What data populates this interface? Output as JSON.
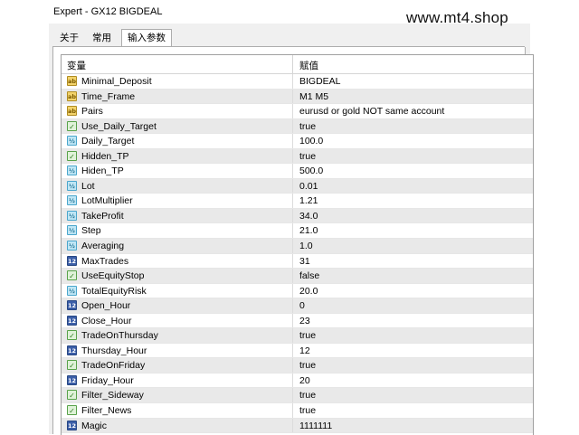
{
  "window": {
    "title": "Expert - GX12 BIGDEAL"
  },
  "watermark": "www.mt4.shop",
  "tabs": [
    {
      "label": "关于",
      "active": false
    },
    {
      "label": "常用",
      "active": false
    },
    {
      "label": "输入参数",
      "active": true
    }
  ],
  "table": {
    "headers": {
      "variable": "变量",
      "value": "赋值"
    },
    "rows": [
      {
        "type": "string",
        "icon": "ab",
        "name": "Minimal_Deposit",
        "value": "BIGDEAL"
      },
      {
        "type": "string",
        "icon": "ab",
        "name": "Time_Frame",
        "value": "M1 M5"
      },
      {
        "type": "string",
        "icon": "ab",
        "name": "Pairs",
        "value": "eurusd or gold NOT same account"
      },
      {
        "type": "bool",
        "icon": "✓",
        "name": "Use_Daily_Target",
        "value": "true"
      },
      {
        "type": "double",
        "icon": "½",
        "name": "Daily_Target",
        "value": "100.0"
      },
      {
        "type": "bool",
        "icon": "✓",
        "name": "Hidden_TP",
        "value": "true"
      },
      {
        "type": "double",
        "icon": "½",
        "name": "Hiden_TP",
        "value": "500.0"
      },
      {
        "type": "double",
        "icon": "½",
        "name": "Lot",
        "value": "0.01"
      },
      {
        "type": "double",
        "icon": "½",
        "name": "LotMultiplier",
        "value": "1.21"
      },
      {
        "type": "double",
        "icon": "½",
        "name": "TakeProfit",
        "value": "34.0"
      },
      {
        "type": "double",
        "icon": "½",
        "name": "Step",
        "value": "21.0"
      },
      {
        "type": "double",
        "icon": "½",
        "name": "Averaging",
        "value": "1.0"
      },
      {
        "type": "int",
        "icon": "123",
        "name": "MaxTrades",
        "value": "31"
      },
      {
        "type": "bool",
        "icon": "✓",
        "name": "UseEquityStop",
        "value": "false"
      },
      {
        "type": "double",
        "icon": "½",
        "name": "TotalEquityRisk",
        "value": "20.0"
      },
      {
        "type": "int",
        "icon": "123",
        "name": "Open_Hour",
        "value": "0"
      },
      {
        "type": "int",
        "icon": "123",
        "name": "Close_Hour",
        "value": "23"
      },
      {
        "type": "bool",
        "icon": "✓",
        "name": "TradeOnThursday",
        "value": "true"
      },
      {
        "type": "int",
        "icon": "123",
        "name": "Thursday_Hour",
        "value": "12"
      },
      {
        "type": "bool",
        "icon": "✓",
        "name": "TradeOnFriday",
        "value": "true"
      },
      {
        "type": "int",
        "icon": "123",
        "name": "Friday_Hour",
        "value": "20"
      },
      {
        "type": "bool",
        "icon": "✓",
        "name": "Filter_Sideway",
        "value": "true"
      },
      {
        "type": "bool",
        "icon": "✓",
        "name": "Filter_News",
        "value": "true"
      },
      {
        "type": "int",
        "icon": "123",
        "name": "Magic",
        "value": "1111111"
      }
    ]
  }
}
